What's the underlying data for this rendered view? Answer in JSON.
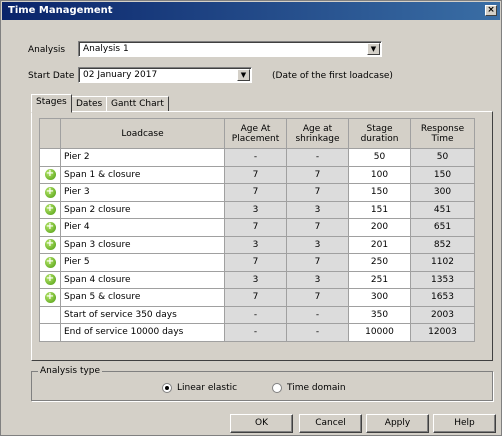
{
  "window": {
    "title": "Time Management",
    "close": "×"
  },
  "analysis": {
    "label": "Analysis",
    "value": "Analysis 1"
  },
  "start_date": {
    "label": "Start Date",
    "value": "02  January  2017",
    "note": "(Date of the first loadcase)"
  },
  "tabs": [
    {
      "label": "Stages",
      "active": true
    },
    {
      "label": "Dates",
      "active": false
    },
    {
      "label": "Gantt Chart",
      "active": false
    }
  ],
  "table": {
    "headers": {
      "loadcase": "Loadcase",
      "age_placement": "Age At Placement",
      "age_shrinkage": "Age at shrinkage",
      "stage_duration": "Stage duration",
      "response_time": "Response Time"
    },
    "rows": [
      {
        "icon": false,
        "loadcase": "Pier 2",
        "age_placement": "-",
        "age_shrinkage": "-",
        "stage_duration": "50",
        "response_time": "50"
      },
      {
        "icon": true,
        "loadcase": "Span 1 & closure",
        "age_placement": "7",
        "age_shrinkage": "7",
        "stage_duration": "100",
        "response_time": "150"
      },
      {
        "icon": true,
        "loadcase": "Pier 3",
        "age_placement": "7",
        "age_shrinkage": "7",
        "stage_duration": "150",
        "response_time": "300"
      },
      {
        "icon": true,
        "loadcase": "Span 2 closure",
        "age_placement": "3",
        "age_shrinkage": "3",
        "stage_duration": "151",
        "response_time": "451"
      },
      {
        "icon": true,
        "loadcase": "Pier 4",
        "age_placement": "7",
        "age_shrinkage": "7",
        "stage_duration": "200",
        "response_time": "651"
      },
      {
        "icon": true,
        "loadcase": "Span 3 closure",
        "age_placement": "3",
        "age_shrinkage": "3",
        "stage_duration": "201",
        "response_time": "852"
      },
      {
        "icon": true,
        "loadcase": "Pier 5",
        "age_placement": "7",
        "age_shrinkage": "7",
        "stage_duration": "250",
        "response_time": "1102"
      },
      {
        "icon": true,
        "loadcase": "Span 4 closure",
        "age_placement": "3",
        "age_shrinkage": "3",
        "stage_duration": "251",
        "response_time": "1353"
      },
      {
        "icon": true,
        "loadcase": "Span 5 & closure",
        "age_placement": "7",
        "age_shrinkage": "7",
        "stage_duration": "300",
        "response_time": "1653"
      },
      {
        "icon": false,
        "loadcase": "Start of service 350 days",
        "age_placement": "-",
        "age_shrinkage": "-",
        "stage_duration": "350",
        "response_time": "2003"
      },
      {
        "icon": false,
        "loadcase": "End of service 10000 days",
        "age_placement": "-",
        "age_shrinkage": "-",
        "stage_duration": "10000",
        "response_time": "12003"
      }
    ]
  },
  "analysis_type": {
    "legend": "Analysis type",
    "options": [
      {
        "label": "Linear elastic",
        "selected": true
      },
      {
        "label": "Time domain",
        "selected": false
      }
    ]
  },
  "buttons": {
    "ok": "OK",
    "cancel": "Cancel",
    "apply": "Apply",
    "help": "Help"
  },
  "icons": {
    "row_icon": "add-circle-icon",
    "dropdown": "chevron-down-icon"
  },
  "colors": {
    "titlebar": "#0a246a",
    "dialog_bg": "#d4d0c8",
    "row_icon": "#4a9a10"
  }
}
